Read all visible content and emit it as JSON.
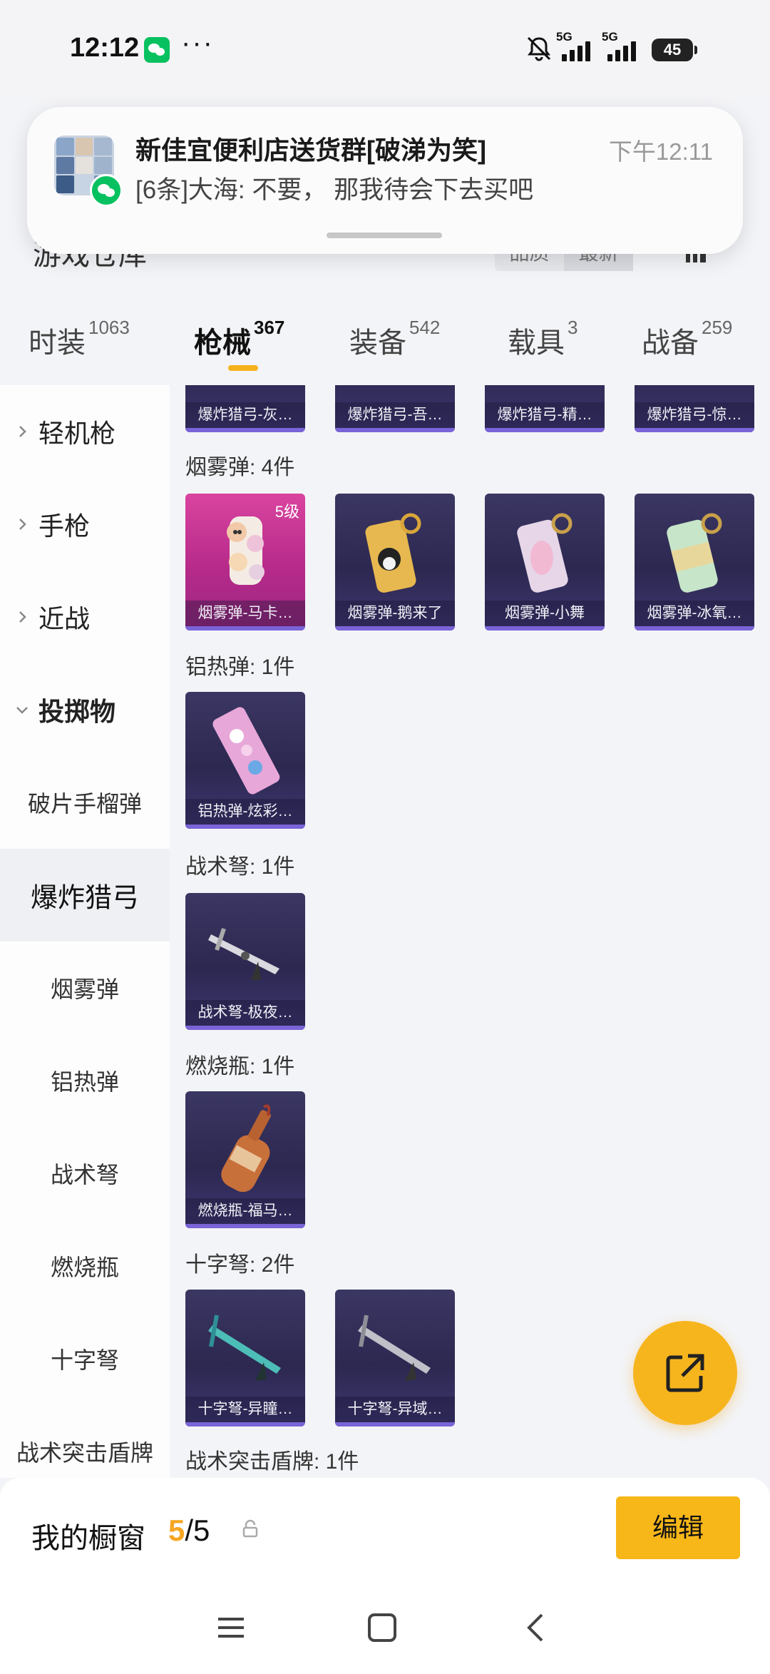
{
  "status": {
    "time": "12:12",
    "dots": "···",
    "sim1": "5G",
    "sim2": "5G",
    "battery": "45"
  },
  "notification": {
    "title": "新佳宜便利店送货群[破涕为笑]",
    "time": "下午12:11",
    "message": "[6条]大海: 不要， 那我待会下去买吧"
  },
  "header": {
    "title": "游戏仓库",
    "sort_a": "品质",
    "sort_b": "最新"
  },
  "tabs": [
    {
      "label": "时装",
      "count": "1063"
    },
    {
      "label": "枪械",
      "count": "367"
    },
    {
      "label": "装备",
      "count": "542"
    },
    {
      "label": "载具",
      "count": "3"
    },
    {
      "label": "战备",
      "count": "259"
    }
  ],
  "sidebar": {
    "categories": [
      "轻机枪",
      "手枪",
      "近战",
      "投掷物"
    ],
    "subs": [
      "破片手榴弹",
      "爆炸猎弓",
      "烟雾弹",
      "铝热弹",
      "战术弩",
      "燃烧瓶",
      "十字弩",
      "战术突击盾牌"
    ]
  },
  "content": {
    "top_cards": [
      "爆炸猎弓-灰…",
      "爆炸猎弓-吾…",
      "爆炸猎弓-精…",
      "爆炸猎弓-惊…"
    ],
    "sections": [
      {
        "title": "烟雾弹: 4件",
        "cards": [
          {
            "name": "烟雾弹-马卡…",
            "level": "5级"
          },
          {
            "name": "烟雾弹-鹅来了"
          },
          {
            "name": "烟雾弹-小舞"
          },
          {
            "name": "烟雾弹-冰氧…"
          }
        ]
      },
      {
        "title": "铝热弹: 1件",
        "cards": [
          {
            "name": "铝热弹-炫彩…"
          }
        ]
      },
      {
        "title": "战术弩: 1件",
        "cards": [
          {
            "name": "战术弩-极夜…"
          }
        ]
      },
      {
        "title": "燃烧瓶: 1件",
        "cards": [
          {
            "name": "燃烧瓶-福马…"
          }
        ]
      },
      {
        "title": "十字弩: 2件",
        "cards": [
          {
            "name": "十字弩-异瞳…"
          },
          {
            "name": "十字弩-异域…"
          }
        ]
      },
      {
        "title": "战术突击盾牌: 1件",
        "cards": []
      }
    ]
  },
  "bottom": {
    "window_label": "我的橱窗",
    "window_current": "5",
    "window_total": "/5",
    "edit_label": "编辑"
  },
  "colors": {
    "accent": "#f7b719",
    "card_bg": "#2c2850",
    "card_pink": "#c0318c"
  }
}
